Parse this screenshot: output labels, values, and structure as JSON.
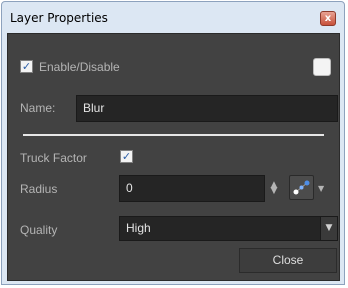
{
  "window": {
    "title": "Layer Properties",
    "close_glyph": "x"
  },
  "enable": {
    "label": "Enable/Disable",
    "checked": true
  },
  "name": {
    "label": "Name:",
    "value": "Blur"
  },
  "truck_factor": {
    "label": "Truck Factor",
    "checked": true
  },
  "radius": {
    "label": "Radius",
    "value": "0"
  },
  "quality": {
    "label": "Quality",
    "value": "High"
  },
  "buttons": {
    "close": "Close"
  },
  "icons": {
    "check": "✓",
    "spin_up": "▲",
    "spin_down": "▼",
    "dropdown": "▼"
  },
  "colors": {
    "panel_bg": "#424242",
    "field_bg": "#252525",
    "title_bg": "#dce7f3",
    "check_color": "#2c5fa8"
  }
}
